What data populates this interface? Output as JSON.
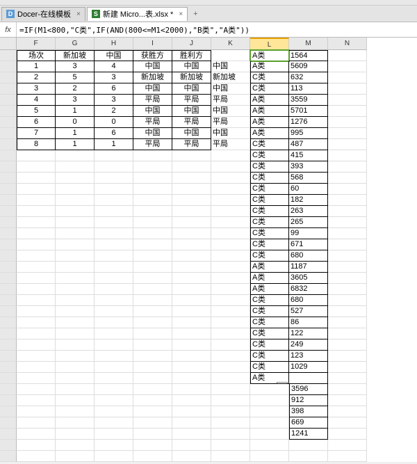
{
  "tabs": [
    {
      "icon": "D",
      "iconbg": "#5b9bd5",
      "label": "Docer-在线模板",
      "active": false
    },
    {
      "icon": "S",
      "iconbg": "#2e7d32",
      "label": "新建 Micro...表.xlsx *",
      "active": true
    }
  ],
  "formulabar": {
    "fx": "fx",
    "formula": "=IF(M1<800,\"C类\",IF(AND(800<=M1<2000),\"B类\",\"A类\"))"
  },
  "columns": [
    "F",
    "G",
    "H",
    "I",
    "J",
    "K",
    "L",
    "M",
    "N"
  ],
  "activeColumn": "L",
  "activeCell": {
    "row": 0,
    "col": 6
  },
  "headers": [
    "场次",
    "新加坡",
    "中国",
    "获胜方",
    "胜利方"
  ],
  "tableRows": [
    {
      "f": "1",
      "g": "3",
      "h": "4",
      "i": "中国",
      "j": "中国",
      "k": "中国"
    },
    {
      "f": "2",
      "g": "5",
      "h": "3",
      "i": "新加坡",
      "j": "新加坡",
      "k": "新加坡"
    },
    {
      "f": "3",
      "g": "2",
      "h": "6",
      "i": "中国",
      "j": "中国",
      "k": "中国"
    },
    {
      "f": "4",
      "g": "3",
      "h": "3",
      "i": "平局",
      "j": "平局",
      "k": "平局"
    },
    {
      "f": "5",
      "g": "1",
      "h": "2",
      "i": "中国",
      "j": "中国",
      "k": "中国"
    },
    {
      "f": "6",
      "g": "0",
      "h": "0",
      "i": "平局",
      "j": "平局",
      "k": "平局"
    },
    {
      "f": "7",
      "g": "1",
      "h": "6",
      "i": "中国",
      "j": "中国",
      "k": "中国"
    },
    {
      "f": "8",
      "g": "1",
      "h": "1",
      "i": "平局",
      "j": "平局",
      "k": "平局"
    }
  ],
  "lcol": [
    "A类",
    "A类",
    "C类",
    "C类",
    "A类",
    "A类",
    "A类",
    "A类",
    "C类",
    "C类",
    "C类",
    "C类",
    "C类",
    "C类",
    "C类",
    "C类",
    "C类",
    "C类",
    "C类",
    "A类",
    "A类",
    "A类",
    "C类",
    "C类",
    "C类",
    "C类",
    "C类",
    "C类",
    "C类",
    "A类"
  ],
  "mcol": [
    "1564",
    "5609",
    "632",
    "113",
    "3559",
    "5701",
    "1276",
    "995",
    "487",
    "415",
    "393",
    "568",
    "60",
    "182",
    "263",
    "265",
    "99",
    "671",
    "680",
    "1187",
    "3605",
    "6832",
    "680",
    "527",
    "86",
    "122",
    "249",
    "123",
    "1029",
    "",
    "3596",
    "912",
    "398",
    "669",
    "1241"
  ],
  "pasteIndicatorRow": 29
}
